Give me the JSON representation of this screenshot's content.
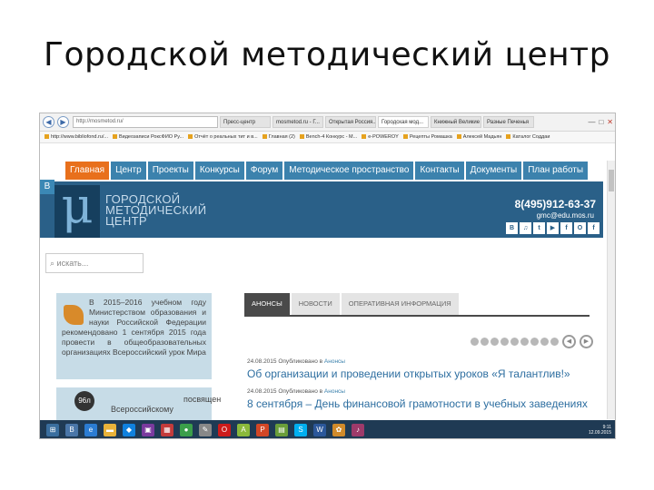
{
  "slide": {
    "title": "Городской методический центр"
  },
  "browser": {
    "url": "http://mosmetod.ru/",
    "tabs": [
      "Пресс-центр",
      "mosmetod.ru - Г...",
      "Открытая Россия...",
      "Городская мод...",
      "Книжный Великие ...",
      "Разные Печенья"
    ],
    "favorites": [
      "http://www.bibliofond.ru/...",
      "Видеозаписи РоксФИО Ру...",
      "Отчёт о реальных тит и в...",
      "Главная (2)",
      "Bench-4 Конкурс - М...",
      "e-POWEROY",
      "Рецепты Ромашка",
      "Алексей Мадьян",
      "Каталог Соддаи"
    ]
  },
  "site": {
    "menu": [
      "Главная",
      "Центр",
      "Проекты",
      "Конкурсы",
      "Форум",
      "Методическое пространство",
      "Контакты",
      "Документы",
      "План работы"
    ],
    "side_tab": "В",
    "logo_mark": "μ",
    "logo_lines": [
      "городской",
      "методический",
      "центр"
    ],
    "phone": "8(495)912-63-37",
    "email": "gmc@edu.mos.ru",
    "socials": [
      "В",
      "♫",
      "t",
      "▶",
      "f",
      "О",
      "f"
    ],
    "search_placeholder": "искать...",
    "news_box_text": "В 2015–2016 учебном году Министерством образования и науки Российской Федерации рекомендовано 1 сентября 2015 года провести в общеобразовательных организациях Всероссийский урок Мира",
    "news_box2": {
      "badge": "96л",
      "line1": "посвящен",
      "line2": "Всероссийскому"
    },
    "content_tabs": [
      "АНОНСЫ",
      "НОВОСТИ",
      "ОПЕРАТИВНАЯ ИНФОРМАЦИЯ"
    ],
    "items": [
      {
        "date": "24.08.2015",
        "published_in": "Опубликовано в",
        "section": "Анонсы",
        "title": "Об организации и проведении открытых уроков «Я талантлив!»"
      },
      {
        "date": "24.08.2015",
        "published_in": "Опубликовано в",
        "section": "Анонсы",
        "title": "8 сентября – День финансовой грамотности в учебных заведениях"
      }
    ]
  },
  "taskbar": {
    "icons": [
      {
        "name": "start-icon",
        "glyph": "⊞",
        "color": "#3a6e9e"
      },
      {
        "name": "vk-icon",
        "glyph": "В",
        "color": "#4a76a8"
      },
      {
        "name": "ie-icon",
        "glyph": "e",
        "color": "#2b7cd3"
      },
      {
        "name": "folder-icon",
        "glyph": "▬",
        "color": "#e8b23a"
      },
      {
        "name": "dropbox-icon",
        "glyph": "◆",
        "color": "#1081de"
      },
      {
        "name": "media-icon",
        "glyph": "▣",
        "color": "#7a3a9e"
      },
      {
        "name": "gallery-icon",
        "glyph": "▦",
        "color": "#c33b3b"
      },
      {
        "name": "chrome-icon",
        "glyph": "●",
        "color": "#3b9e4a"
      },
      {
        "name": "tool-icon",
        "glyph": "✎",
        "color": "#888888"
      },
      {
        "name": "opera-icon",
        "glyph": "O",
        "color": "#cc1b1b"
      },
      {
        "name": "android-icon",
        "glyph": "A",
        "color": "#8ab93b"
      },
      {
        "name": "powerpoint-icon",
        "glyph": "P",
        "color": "#d24726"
      },
      {
        "name": "chart-icon",
        "glyph": "▤",
        "color": "#6a9e3a"
      },
      {
        "name": "skype-icon",
        "glyph": "S",
        "color": "#00aff0"
      },
      {
        "name": "word-icon",
        "glyph": "W",
        "color": "#2b579a"
      },
      {
        "name": "paint-icon",
        "glyph": "✿",
        "color": "#d08a2a"
      },
      {
        "name": "music-icon",
        "glyph": "♪",
        "color": "#9e3a6a"
      }
    ],
    "time": "9:11",
    "date": "12.09.2015"
  }
}
